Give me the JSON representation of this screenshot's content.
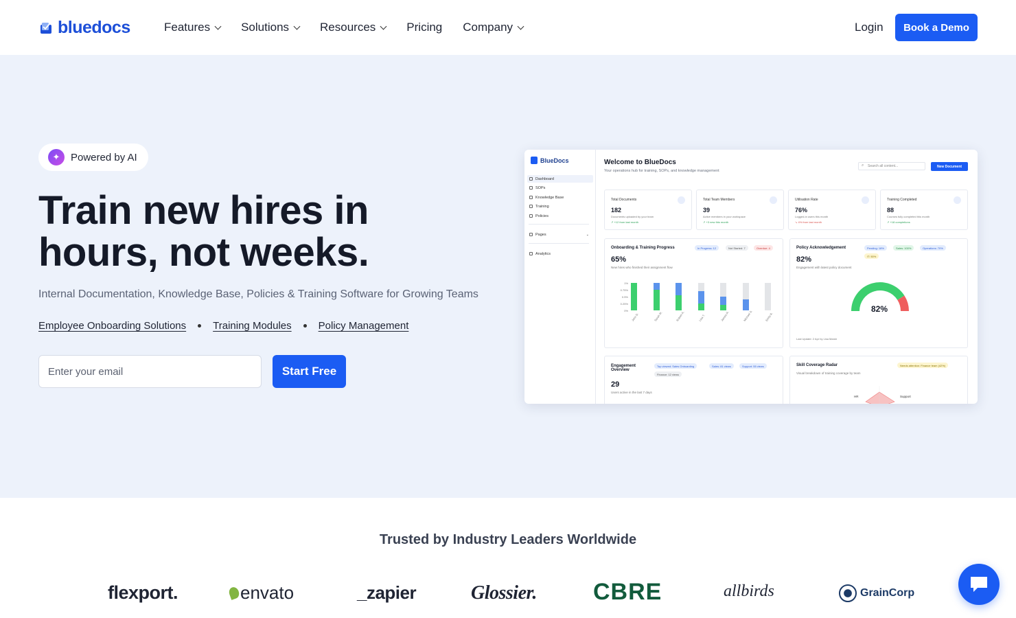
{
  "nav": {
    "logo": "bluedocs",
    "items": [
      {
        "label": "Features",
        "dropdown": true
      },
      {
        "label": "Solutions",
        "dropdown": true
      },
      {
        "label": "Resources",
        "dropdown": true
      },
      {
        "label": "Pricing",
        "dropdown": false
      },
      {
        "label": "Company",
        "dropdown": true
      }
    ],
    "login": "Login",
    "cta": "Book a Demo"
  },
  "hero": {
    "badge": "Powered by AI",
    "headline_line1": "Train new hires in",
    "headline_line2": "hours, not weeks.",
    "subtitle": "Internal Documentation, Knowledge Base, Policies & Training Software for Growing Teams",
    "links": [
      "Employee Onboarding Solutions",
      "Training Modules",
      "Policy Management"
    ],
    "email_placeholder": "Enter your email",
    "start_button": "Start Free"
  },
  "dashboard": {
    "logo": "BlueDocs",
    "sidebar": [
      "Dashboard",
      "SOPs",
      "Knowledge Base",
      "Training",
      "Policies"
    ],
    "sidebar_pages": "Pages",
    "sidebar_analytics": "Analytics",
    "title": "Welcome to BlueDocs",
    "subtitle": "Your operations hub for training, SOPs, and knowledge management",
    "search_placeholder": "Search all content...",
    "new_doc": "New Document",
    "stats": [
      {
        "label": "Total Documents",
        "value": "182",
        "desc": "Documents uploaded by your team",
        "trend": "↗ +12 from last month",
        "down": false
      },
      {
        "label": "Total Team Members",
        "value": "39",
        "desc": "Active members in your workspace",
        "trend": "↗ +3 new this month",
        "down": false
      },
      {
        "label": "Utilisation Rate",
        "value": "76%",
        "desc": "Logged-in users this month",
        "trend": "↘ 4% from last month",
        "down": true
      },
      {
        "label": "Training Completed",
        "value": "88",
        "desc": "Courses fully completed this month",
        "trend": "↗ +18 completions",
        "down": false
      }
    ],
    "onboarding": {
      "title": "Onboarding & Training Progress",
      "value": "65%",
      "desc": "New hires who finished their assignment flow",
      "pills": [
        "In Progress: 12",
        "Not Started: 7",
        "Overdue: 4"
      ]
    },
    "policy": {
      "title": "Policy Acknowledgement",
      "value": "82%",
      "desc": "Engagement with latest policy document",
      "pills": [
        "Pending: 18%",
        "Sales: 100%",
        "Operations: 70%",
        "IT: 50%"
      ],
      "gauge_label": "82%",
      "gauge_value": 0.82,
      "footer": "Last Update: 2 Apr by Lisa Marsh"
    },
    "engagement": {
      "title_line1": "Engagement",
      "title_line2": "Overview",
      "value": "29",
      "desc": "Users active in the last 7 days",
      "pills": [
        "Top viewed: Sales Onboarding",
        "Sales: 81 views",
        "Support: 55 views",
        "Finance: 12 views"
      ]
    },
    "radar": {
      "title": "Skill Coverage Radar",
      "desc": "Visual breakdown of training coverage by team",
      "pill": "Needs attention: Finance team (42%)",
      "labels": [
        "HR",
        "Support"
      ]
    },
    "colors": {
      "completed": "#3ccf6e",
      "in_progress": "#5b93ec",
      "remaining": "#e3e5e8",
      "gauge_green": "#3ccf6e",
      "gauge_red": "#ef5e5e"
    }
  },
  "chart_data": {
    "type": "bar",
    "categories": [
      "John D.",
      "Sarah M.",
      "Robert K.",
      "Lisa T.",
      "James R.",
      "Michael S.",
      "Emily R."
    ],
    "yticks": [
      "1%",
      "0.75%",
      "0.5%",
      "0.25%",
      "0%"
    ],
    "ylim": [
      0,
      1
    ],
    "series": [
      {
        "name": "Completed",
        "values": [
          1.0,
          0.75,
          0.55,
          0.25,
          0.2,
          0.0,
          0.0
        ]
      },
      {
        "name": "In Progress",
        "values": [
          0.0,
          0.25,
          0.45,
          0.45,
          0.3,
          0.4,
          0.0
        ]
      },
      {
        "name": "Not Started",
        "values": [
          0.0,
          0.0,
          0.0,
          0.3,
          0.5,
          0.6,
          1.0
        ]
      }
    ]
  },
  "trust": {
    "title": "Trusted by Industry Leaders Worldwide",
    "logos": [
      "flexport.",
      "envato",
      "_zapier",
      "Glossier.",
      "CBRE",
      "allbirds",
      "GrainCorp"
    ]
  }
}
